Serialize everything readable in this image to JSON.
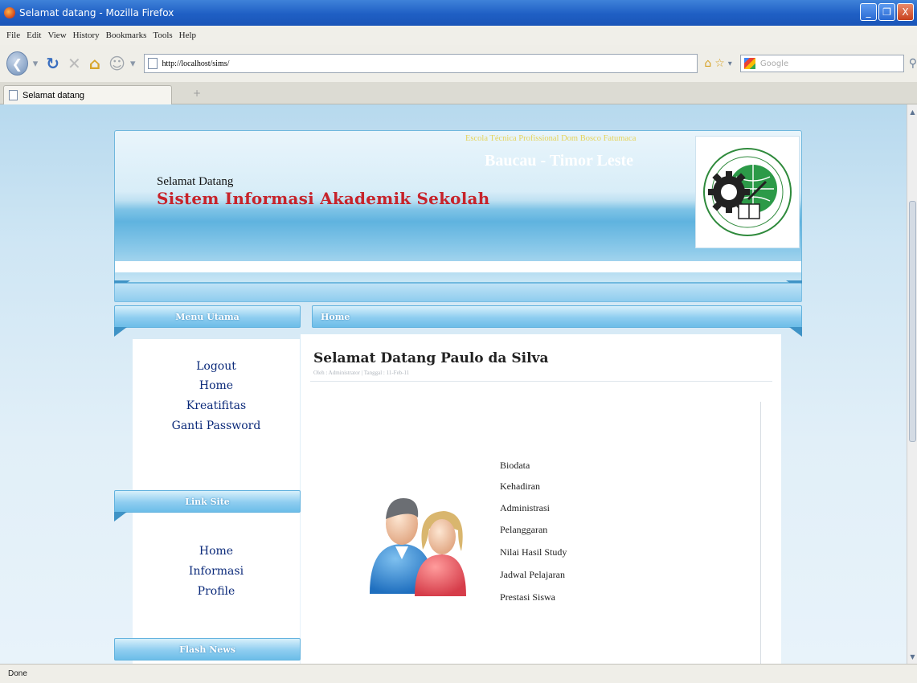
{
  "window": {
    "title": "Selamat datang - Mozilla Firefox",
    "controls": [
      "_",
      "❐",
      "X"
    ]
  },
  "menubar": {
    "items": [
      "File",
      "Edit",
      "View",
      "History",
      "Bookmarks",
      "Tools",
      "Help"
    ]
  },
  "navbar": {
    "url": "http://localhost/sims/",
    "search_placeholder": "Google"
  },
  "tabs": [
    {
      "label": "Selamat datang"
    }
  ],
  "new_tab_label": "+",
  "header": {
    "welcome_small": "Selamat Datang",
    "system_title": "Sistem Informasi Akademik Sekolah",
    "school_name": "Escola Técnica Profissional Dom Bosco Fatumaca",
    "location": "Baucau - Timor Leste"
  },
  "sidebar": {
    "menu_title": "Menu Utama",
    "menu_items": [
      "Logout",
      "Home",
      "Kreatifitas",
      "Ganti Password"
    ],
    "links_title": "Link Site",
    "link_items": [
      "Home",
      "Informasi",
      "Profile"
    ],
    "flash_title": "Flash News"
  },
  "main": {
    "section_title": "Home",
    "heading": "Selamat Datang Paulo da Silva",
    "byline": "Oleh : Administrator | Tanggal : 11-Feb-11",
    "menu_links": [
      "Biodata",
      "Kehadiran",
      "Administrasi",
      "Pelanggaran",
      "Nilai Hasil Study",
      "Jadwal Pelajaran",
      "Prestasi Siswa"
    ]
  },
  "status": {
    "text": "Done"
  },
  "colors": {
    "title_red": "#c7232a",
    "link_blue": "#0b2a7a",
    "school_name_yellow": "#e6d35a"
  }
}
